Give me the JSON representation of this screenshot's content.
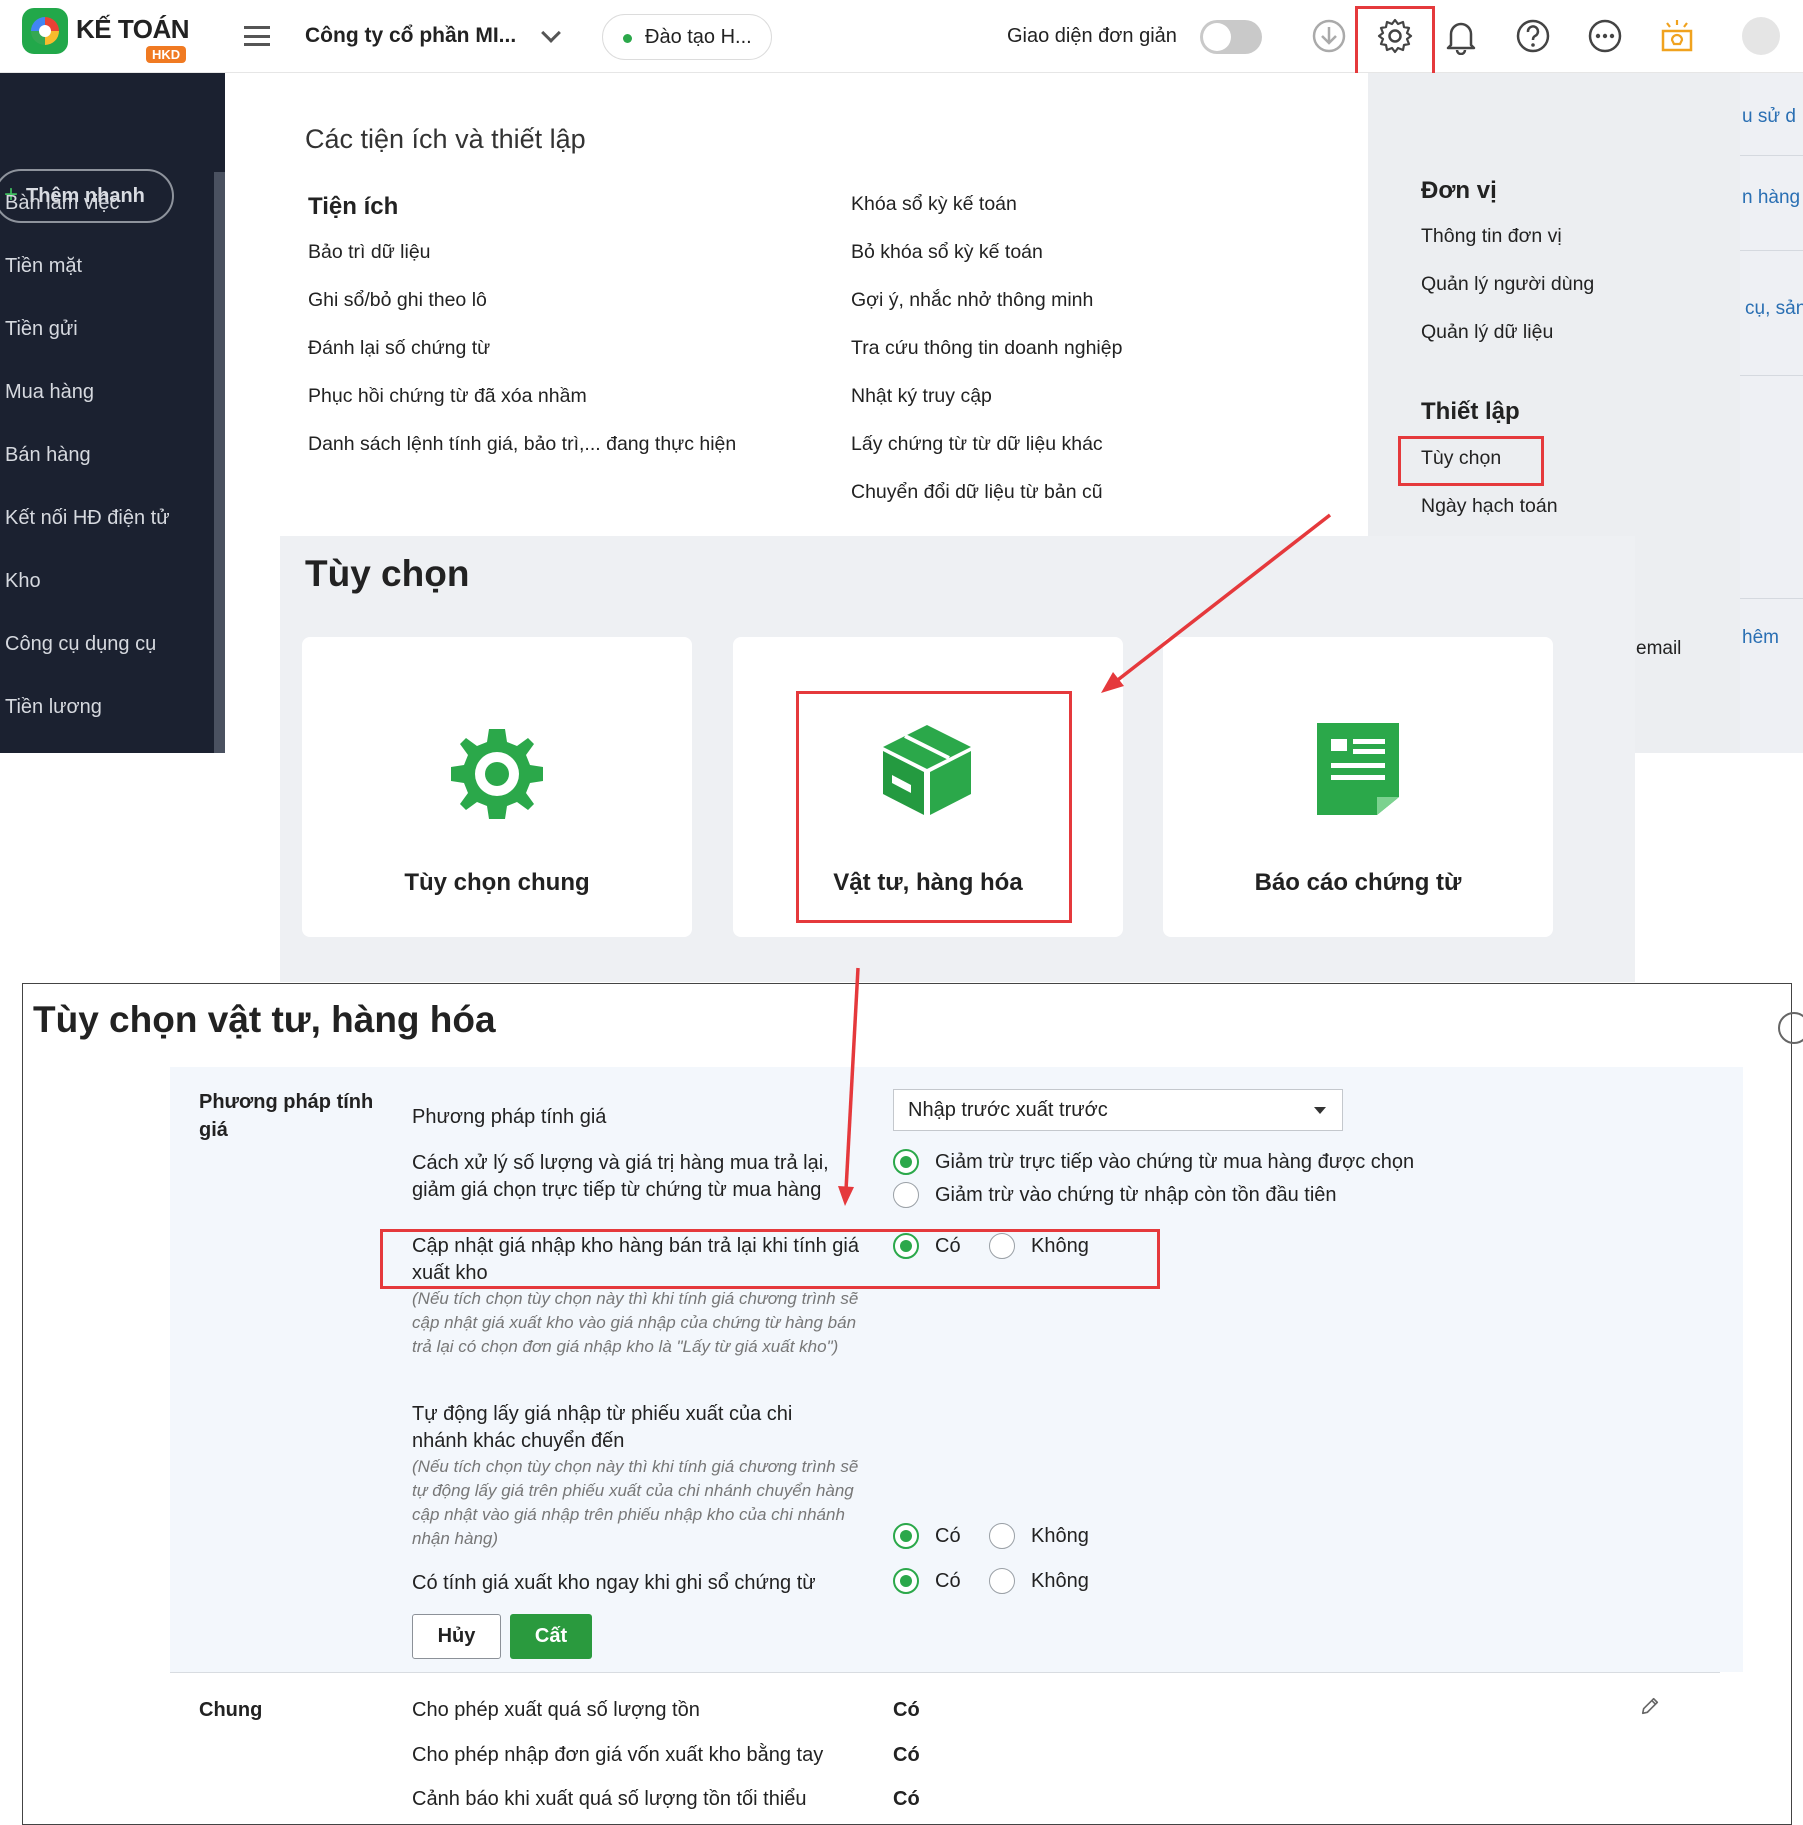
{
  "topbar": {
    "logo_text": "KẾ TOÁN",
    "logo_badge": "HKD",
    "company": "Công ty cổ phần MI...",
    "branch": "Đào tạo H...",
    "simple_mode_label": "Giao diện đơn giản",
    "simple_mode_on": false,
    "icons": [
      "download-icon",
      "gear-icon",
      "bell-icon",
      "help-icon",
      "more-icon",
      "idea-icon",
      "avatar"
    ]
  },
  "sidebar": {
    "quick_add": "Thêm nhanh",
    "items": [
      "Bàn làm việc",
      "Tiền mặt",
      "Tiền gửi",
      "Mua hàng",
      "Bán hàng",
      "Kết nối HĐ điện tử",
      "Kho",
      "Công cụ dụng cụ",
      "Tiền lương"
    ]
  },
  "background_fragments": [
    "u sử d",
    "n hàng",
    "cụ, sản",
    "hêm",
    "email"
  ],
  "settings_panel": {
    "title": "Các tiện ích và thiết lập",
    "utilities_heading": "Tiện ích",
    "utilities_left": [
      "Bảo trì dữ liệu",
      "Ghi sổ/bỏ ghi theo lô",
      "Đánh lại số chứng từ",
      "Phục hồi chứng từ đã xóa nhầm",
      "Danh sách lệnh tính giá, bảo trì,... đang thực hiện"
    ],
    "utilities_right": [
      "Khóa sổ kỳ kế toán",
      "Bỏ khóa sổ kỳ kế toán",
      "Gợi ý, nhắc nhở thông minh",
      "Tra cứu thông tin doanh nghiệp",
      "Nhật ký truy cập",
      "Lấy chứng từ từ dữ liệu khác",
      "Chuyển đổi dữ liệu từ bản cũ"
    ],
    "unit_heading": "Đơn vị",
    "unit_items": [
      "Thông tin đơn vị",
      "Quản lý người dùng",
      "Quản lý dữ liệu"
    ],
    "setup_heading": "Thiết lập",
    "setup_items": [
      "Tùy chọn",
      "Ngày hạch toán"
    ]
  },
  "options": {
    "title": "Tùy chọn",
    "cards": [
      "Tùy chọn chung",
      "Vật tư, hàng hóa",
      "Báo cáo chứng từ"
    ]
  },
  "dialog": {
    "title": "Tùy chọn vật tư, hàng hóa",
    "costing_group": "Phương pháp tính giá",
    "costing_method_label": "Phương pháp tính giá",
    "costing_method_value": "Nhập trước xuất trước",
    "return_handling_label": "Cách xử lý số lượng và giá trị hàng mua trả lại, giảm giá chọn trực tiếp từ chứng từ mua hàng",
    "return_option_1": "Giảm trừ trực tiếp vào chứng từ mua hàng được chọn",
    "return_option_2": "Giảm trừ vào chứng từ nhập còn tồn đầu tiên",
    "update_price_label": "Cập nhật giá nhập kho hàng bán trả lại khi tính giá xuất kho",
    "update_price_note": "(Nếu tích chọn tùy chọn này thì khi tính giá chương trình sẽ cập nhật giá xuất kho vào giá nhập của chứng từ hàng bán trả lại có chọn đơn giá nhập kho là \"Lấy từ giá xuất kho\")",
    "auto_price_label": "Tự động lấy giá nhập từ phiếu xuất của chi nhánh khác chuyển đến",
    "auto_price_note": "(Nếu tích chọn tùy chọn này thì khi tính giá chương trình sẽ tự động lấy giá trên phiếu xuất của chi nhánh chuyển hàng cập nhật vào giá nhập trên phiếu nhập kho của chi nhánh nhận hàng)",
    "calc_on_post_label": "Có tính giá xuất kho ngay khi ghi sổ chứng từ",
    "yes": "Có",
    "no": "Không",
    "cancel_button": "Hủy",
    "save_button": "Cất",
    "general_group": "Chung",
    "general_rows": [
      {
        "label": "Cho phép xuất quá số lượng tồn",
        "value": "Có"
      },
      {
        "label": "Cho phép nhập đơn giá vốn xuất kho bằng tay",
        "value": "Có"
      },
      {
        "label": "Cảnh báo khi xuất quá số lượng tồn tối thiểu",
        "value": "Có"
      }
    ]
  },
  "colors": {
    "brand_green": "#2ba84a",
    "highlight_red": "#e5393c",
    "sidebar_dark": "#1b2130",
    "badge_orange": "#f07a22"
  }
}
